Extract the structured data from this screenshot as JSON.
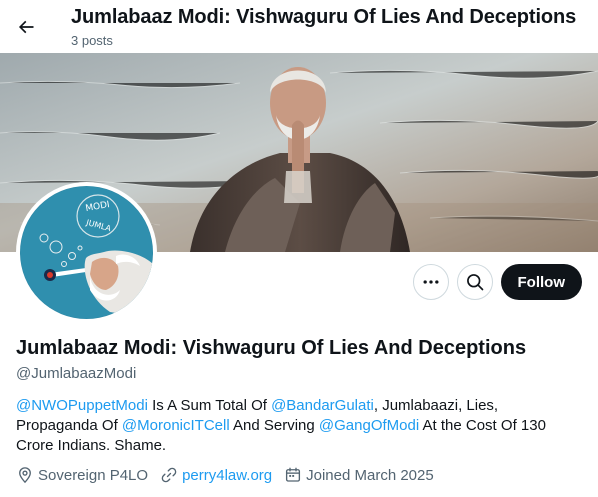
{
  "header": {
    "title": "Jumlabaaz Modi: Vishwaguru Of Lies And Deceptions",
    "post_count": "3 posts"
  },
  "icons": {
    "back": "arrow-left-icon",
    "more": "ellipsis-icon",
    "search": "search-icon",
    "location": "location-pin-icon",
    "link": "link-icon",
    "calendar": "calendar-icon"
  },
  "avatar": {
    "caption_top": "MODI",
    "caption_bottom": "JUMLA"
  },
  "actions": {
    "follow_label": "Follow"
  },
  "profile": {
    "display_name": "Jumlabaaz Modi: Vishwaguru Of Lies And Deceptions",
    "handle": "@JumlabaazModi"
  },
  "bio": {
    "mention1": "@NWOPuppetModi",
    "text1": " Is A Sum Total Of ",
    "mention2": "@BandarGulati",
    "text2": ", Jumlabaazi, Lies, Propaganda Of ",
    "mention3": "@MoronicITCell",
    "text3": " And Serving ",
    "mention4": "@GangOfModi",
    "text4": " At the Cost Of 130 Crore Indians. Shame."
  },
  "meta": {
    "location": "Sovereign P4LO",
    "website": "perry4law.org",
    "joined": "Joined March 2025"
  },
  "colors": {
    "accent": "#1d9bf0",
    "text_primary": "#0f1419",
    "text_secondary": "#536471",
    "border": "#cfd9de"
  }
}
